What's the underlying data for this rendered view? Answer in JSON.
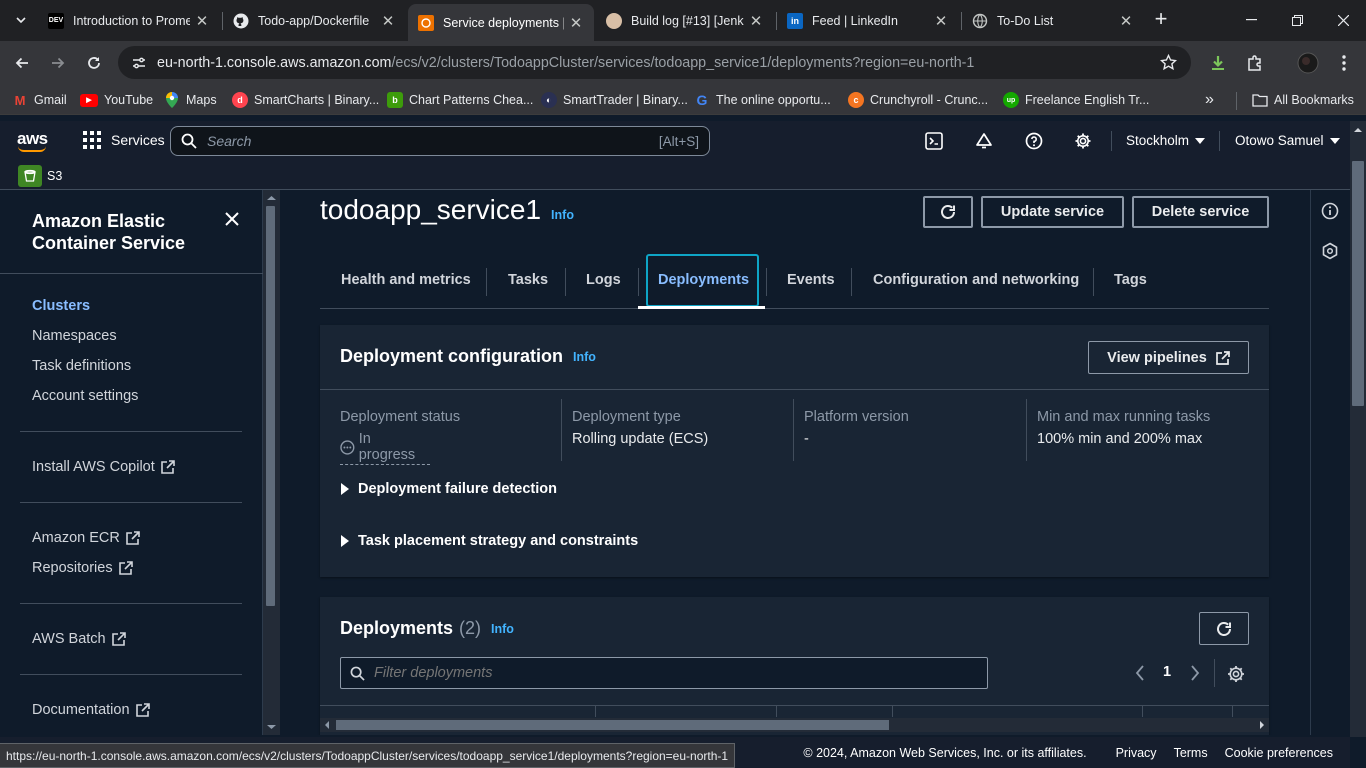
{
  "browser": {
    "tabs": [
      {
        "title": "Introduction to Prome",
        "favicon": "DEV"
      },
      {
        "title": "Todo-app/Dockerfile",
        "favicon": "github-icon"
      },
      {
        "title": "Service deployments |",
        "favicon": "aws-icon"
      },
      {
        "title": "Build log [#13] [Jenki",
        "favicon": "jenkins-icon"
      },
      {
        "title": "Feed | LinkedIn",
        "favicon": "in"
      },
      {
        "title": "To-Do List",
        "favicon": "globe-icon"
      }
    ],
    "url_host": "eu-north-1.console.aws.amazon.com",
    "url_path": "/ecs/v2/clusters/TodoappCluster/services/todoapp_service1/deployments?region=eu-north-1",
    "bookmarks": [
      {
        "label": "Gmail",
        "icon": "M",
        "color": "#ea4335"
      },
      {
        "label": "YouTube",
        "icon": "▶",
        "color": "#ff0000"
      },
      {
        "label": "Maps",
        "icon": "•",
        "color": "#34a853"
      },
      {
        "label": "SmartCharts | Binary...",
        "icon": "d",
        "color": "#ff444f"
      },
      {
        "label": "Chart Patterns Chea...",
        "icon": "b",
        "color": "#3d9c0b"
      },
      {
        "label": "SmartTrader | Binary...",
        "icon": "◐",
        "color": "#2a3052"
      },
      {
        "label": "The online opportu...",
        "icon": "G",
        "color": "#4285f4"
      },
      {
        "label": "Crunchyroll - Crunc...",
        "icon": "c",
        "color": "#f47521"
      },
      {
        "label": "Freelance English Tr...",
        "icon": "up",
        "color": "#14a800"
      }
    ],
    "all_bookmarks": "All Bookmarks",
    "more": "»",
    "status_url": "https://eu-north-1.console.aws.amazon.com/ecs/v2/clusters/TodoappCluster/services/todoapp_service1/deployments?region=eu-north-1"
  },
  "aws_header": {
    "logo": "aws",
    "services": "Services",
    "search_placeholder": "Search",
    "search_shortcut": "[Alt+S]",
    "region": "Stockholm",
    "user": "Otowo Samuel",
    "favorite": "S3"
  },
  "sidebar": {
    "title": "Amazon Elastic Container Service",
    "group1": [
      "Clusters",
      "Namespaces",
      "Task definitions",
      "Account settings"
    ],
    "install_copilot": "Install AWS Copilot",
    "ecr": "Amazon ECR",
    "repositories": "Repositories",
    "batch": "AWS Batch",
    "documentation": "Documentation"
  },
  "page": {
    "title": "todoapp_service1",
    "info": "Info",
    "update_button": "Update service",
    "delete_button": "Delete service",
    "tabs": [
      "Health and metrics",
      "Tasks",
      "Logs",
      "Deployments",
      "Events",
      "Configuration and networking",
      "Tags"
    ],
    "active_tab": "Deployments"
  },
  "deployment_config": {
    "title": "Deployment configuration",
    "info": "Info",
    "view_pipelines": "View pipelines",
    "fields": [
      {
        "label": "Deployment status",
        "value": "In progress"
      },
      {
        "label": "Deployment type",
        "value": "Rolling update (ECS)"
      },
      {
        "label": "Platform version",
        "value": "-"
      },
      {
        "label": "Min and max running tasks",
        "value": "100% min and 200% max"
      }
    ],
    "failure_detection": "Deployment failure detection",
    "placement": "Task placement strategy and constraints"
  },
  "deployments": {
    "title": "Deployments",
    "count": "(2)",
    "info": "Info",
    "filter_placeholder": "Filter deployments",
    "page": "1"
  },
  "footer": {
    "copyright": "© 2024, Amazon Web Services, Inc. or its affiliates.",
    "privacy": "Privacy",
    "terms": "Terms",
    "cookies": "Cookie preferences"
  }
}
